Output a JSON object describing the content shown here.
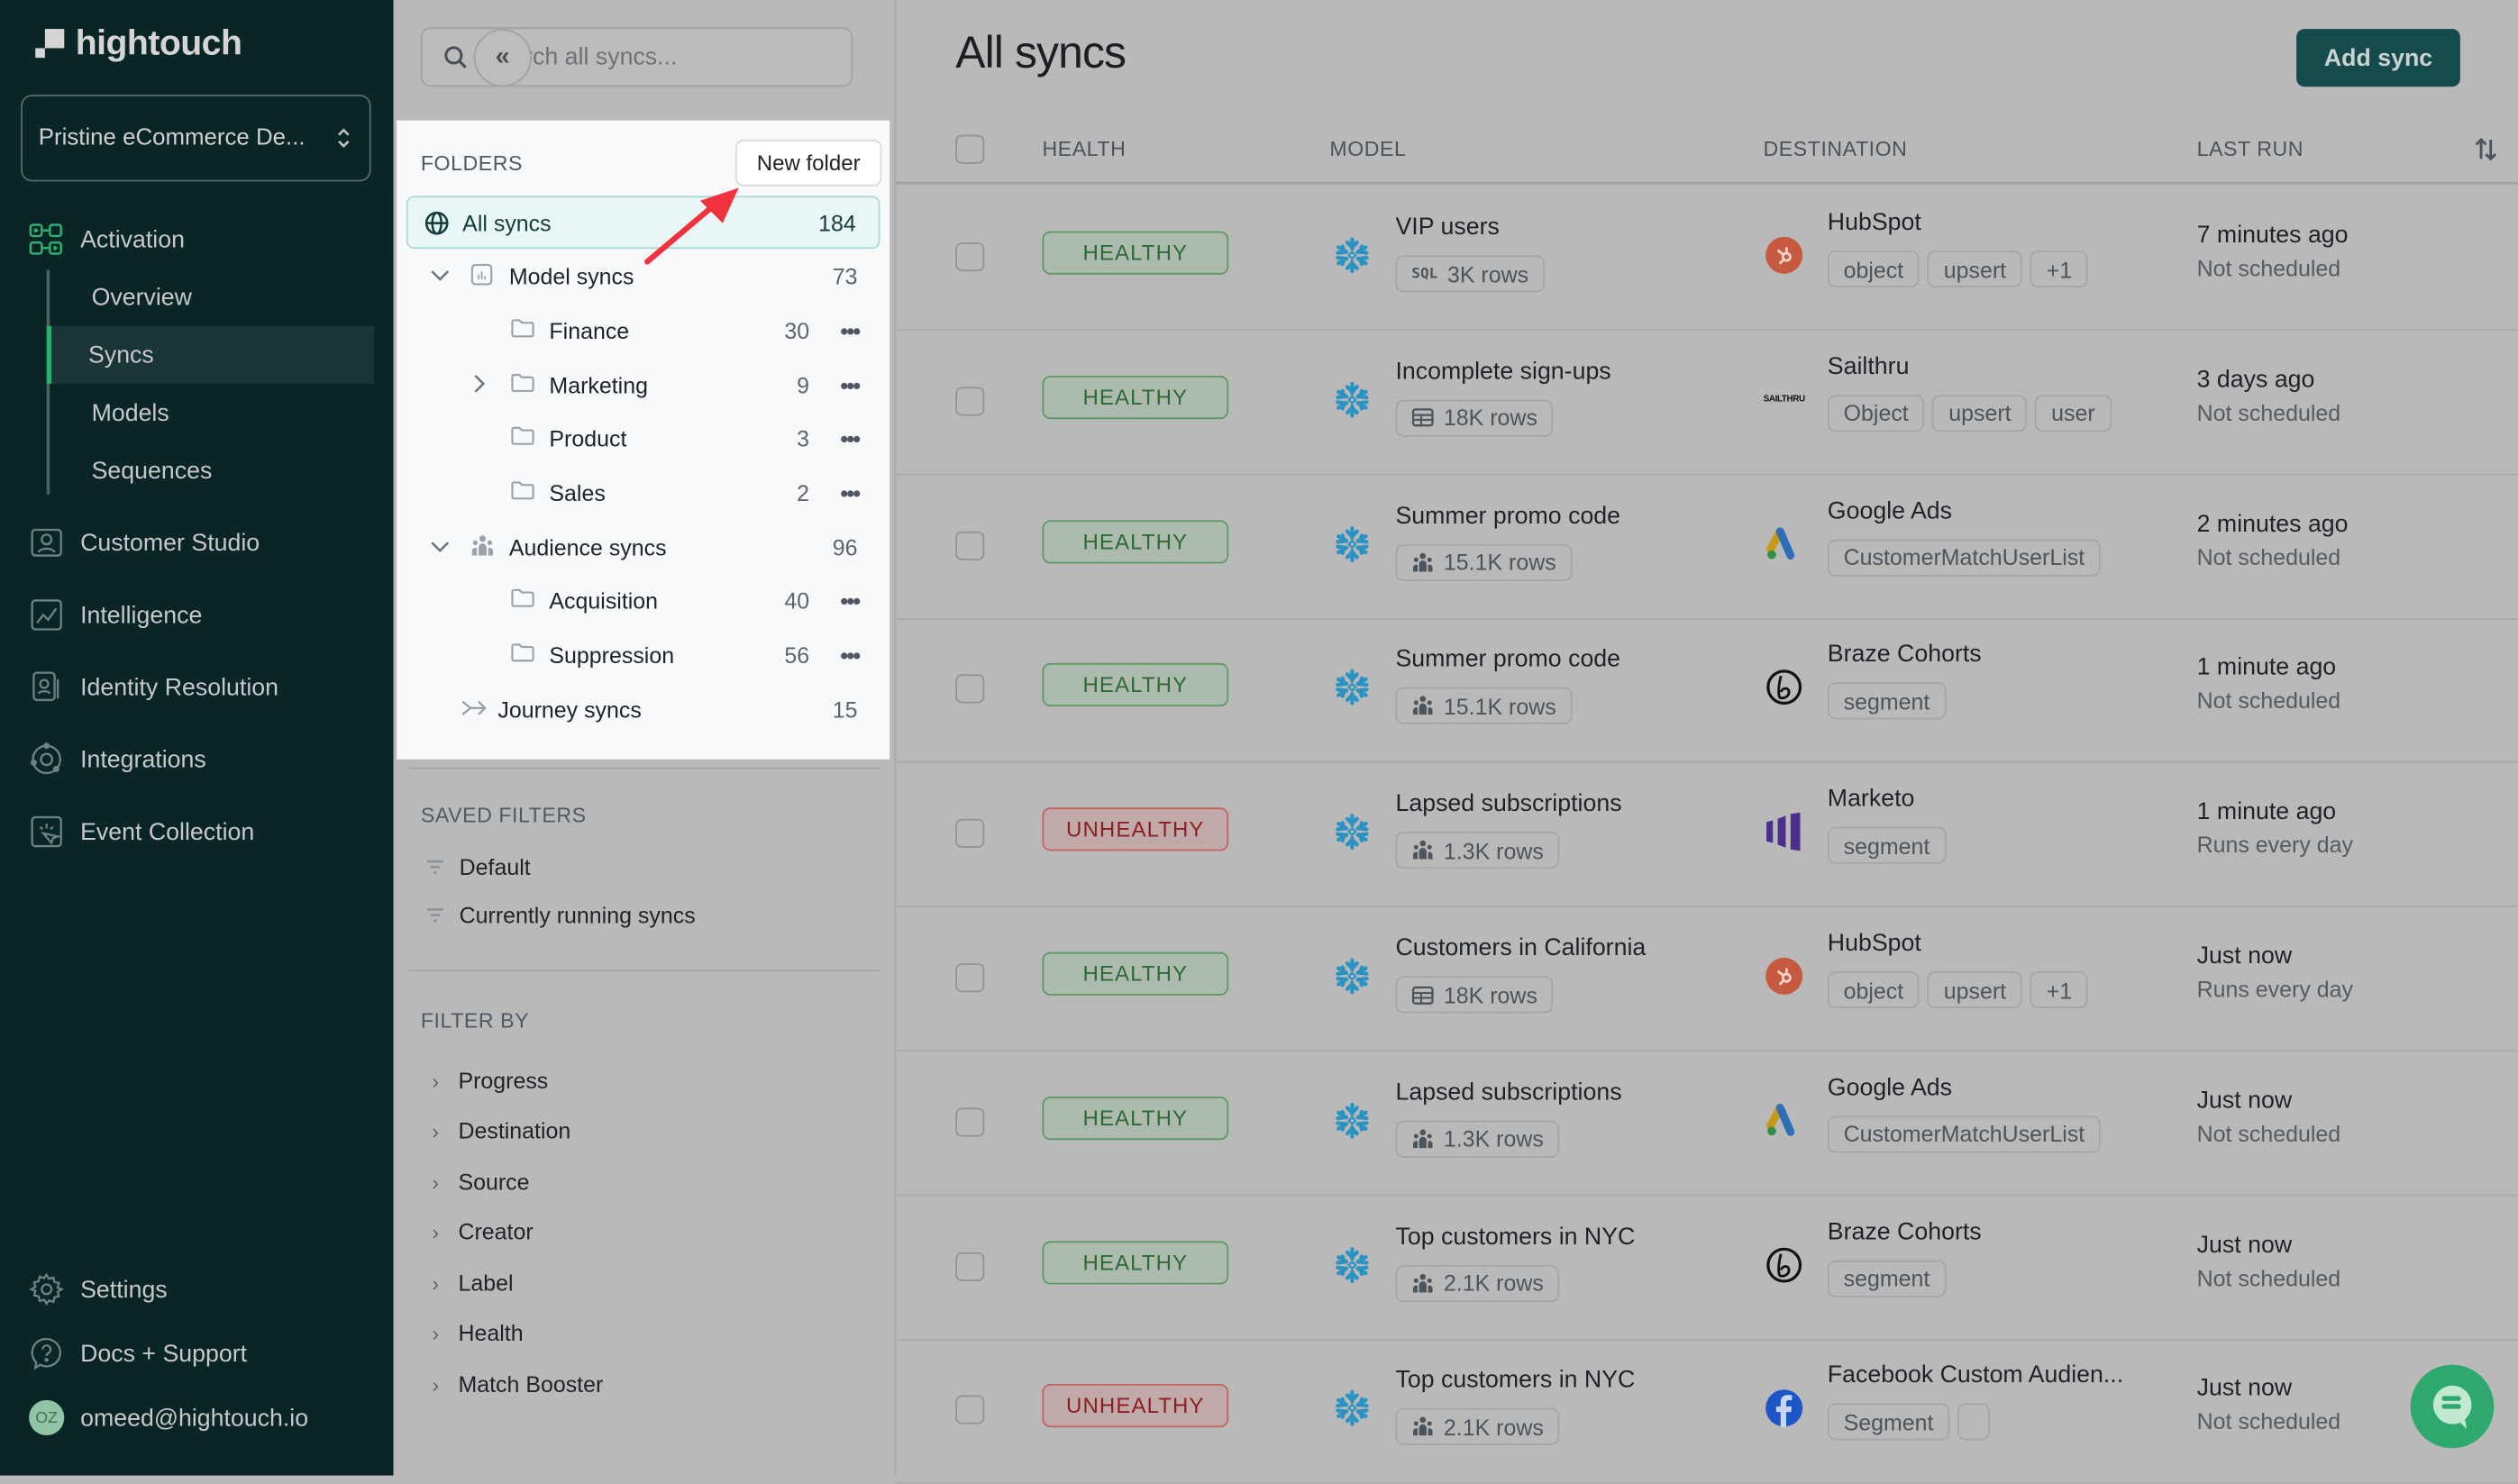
{
  "brand": {
    "name": "hightouch"
  },
  "workspace": {
    "name": "Pristine eCommerce De..."
  },
  "nav": {
    "items": [
      {
        "label": "Activation",
        "icon": "activation-icon"
      },
      {
        "label": "Customer Studio",
        "icon": "customer-studio-icon"
      },
      {
        "label": "Intelligence",
        "icon": "intelligence-icon"
      },
      {
        "label": "Identity Resolution",
        "icon": "identity-resolution-icon"
      },
      {
        "label": "Integrations",
        "icon": "integrations-icon"
      },
      {
        "label": "Event Collection",
        "icon": "event-collection-icon"
      }
    ],
    "activation_sub": [
      {
        "label": "Overview"
      },
      {
        "label": "Syncs",
        "active": true
      },
      {
        "label": "Models"
      },
      {
        "label": "Sequences"
      }
    ],
    "bottom": [
      {
        "label": "Settings",
        "icon": "gear-icon"
      },
      {
        "label": "Docs + Support",
        "icon": "help-icon"
      }
    ],
    "user": {
      "initials": "OZ",
      "email": "omeed@hightouch.io"
    }
  },
  "filter_panel": {
    "search_placeholder": "Search all syncs...",
    "collapse_label": "«",
    "folders_title": "FOLDERS",
    "new_folder_label": "New folder",
    "folders": [
      {
        "label": "All syncs",
        "count": "184",
        "icon": "globe-icon",
        "selected": true
      },
      {
        "label": "Model syncs",
        "count": "73",
        "icon": "model-icon",
        "expanded": true
      },
      {
        "label": "Finance",
        "count": "30",
        "icon": "folder-icon"
      },
      {
        "label": "Marketing",
        "count": "9",
        "icon": "folder-icon",
        "collapsed": true
      },
      {
        "label": "Product",
        "count": "3",
        "icon": "folder-icon"
      },
      {
        "label": "Sales",
        "count": "2",
        "icon": "folder-icon"
      },
      {
        "label": "Audience syncs",
        "count": "96",
        "icon": "audience-icon",
        "expanded": true
      },
      {
        "label": "Acquisition",
        "count": "40",
        "icon": "folder-icon"
      },
      {
        "label": "Suppression",
        "count": "56",
        "icon": "folder-icon"
      },
      {
        "label": "Journey syncs",
        "count": "15",
        "icon": "journey-icon"
      }
    ],
    "more_label": "•••",
    "saved_filters_title": "SAVED FILTERS",
    "saved_filters": [
      {
        "label": "Default"
      },
      {
        "label": "Currently running syncs"
      }
    ],
    "filter_by_title": "FILTER BY",
    "filter_by": [
      {
        "label": "Progress"
      },
      {
        "label": "Destination"
      },
      {
        "label": "Source"
      },
      {
        "label": "Creator"
      },
      {
        "label": "Label"
      },
      {
        "label": "Health"
      },
      {
        "label": "Match Booster"
      }
    ]
  },
  "main": {
    "title": "All syncs",
    "add_sync_label": "Add sync",
    "columns": {
      "health": "HEALTH",
      "model": "MODEL",
      "destination": "DESTINATION",
      "last_run": "LAST RUN"
    },
    "colors": {
      "accent": "#154b4c",
      "healthy": "#2d6a34",
      "unhealthy": "#8a1f1f",
      "snowflake": "#29a3d9"
    },
    "rows": [
      {
        "health": "HEALTHY",
        "status": "healthy",
        "model": "VIP users",
        "rows_icon": "sql-icon",
        "rows_prefix": "SQL",
        "rows": "3K rows",
        "destination": "HubSpot",
        "dest_icon": "hubspot",
        "tags": [
          "object",
          "upsert",
          "+1"
        ],
        "last_run": "7 minutes ago",
        "schedule": "Not scheduled"
      },
      {
        "health": "HEALTHY",
        "status": "healthy",
        "model": "Incomplete sign-ups",
        "rows_icon": "table-icon",
        "rows": "18K rows",
        "destination": "Sailthru",
        "dest_icon": "sailthru",
        "dest_logo_text": "SAILTHRU",
        "tags": [
          "Object",
          "upsert",
          "user"
        ],
        "last_run": "3 days ago",
        "schedule": "Not scheduled"
      },
      {
        "health": "HEALTHY",
        "status": "healthy",
        "model": "Summer promo code",
        "rows_icon": "audience-icon",
        "rows": "15.1K rows",
        "destination": "Google Ads",
        "dest_icon": "googleads",
        "tags": [
          "CustomerMatchUserList"
        ],
        "last_run": "2 minutes ago",
        "schedule": "Not scheduled"
      },
      {
        "health": "HEALTHY",
        "status": "healthy",
        "model": "Summer promo code",
        "rows_icon": "audience-icon",
        "rows": "15.1K rows",
        "destination": "Braze Cohorts",
        "dest_icon": "braze",
        "tags": [
          "segment"
        ],
        "last_run": "1 minute ago",
        "schedule": "Not scheduled"
      },
      {
        "health": "UNHEALTHY",
        "status": "unhealthy",
        "model": "Lapsed subscriptions",
        "rows_icon": "audience-icon",
        "rows": "1.3K rows",
        "destination": "Marketo",
        "dest_icon": "marketo",
        "tags": [
          "segment"
        ],
        "last_run": "1 minute ago",
        "schedule": "Runs every day"
      },
      {
        "health": "HEALTHY",
        "status": "healthy",
        "model": "Customers in California",
        "rows_icon": "table-icon",
        "rows": "18K rows",
        "destination": "HubSpot",
        "dest_icon": "hubspot",
        "tags": [
          "object",
          "upsert",
          "+1"
        ],
        "last_run": "Just now",
        "schedule": "Runs every day"
      },
      {
        "health": "HEALTHY",
        "status": "healthy",
        "model": "Lapsed subscriptions",
        "rows_icon": "audience-icon",
        "rows": "1.3K rows",
        "destination": "Google Ads",
        "dest_icon": "googleads",
        "tags": [
          "CustomerMatchUserList"
        ],
        "last_run": "Just now",
        "schedule": "Not scheduled"
      },
      {
        "health": "HEALTHY",
        "status": "healthy",
        "model": "Top customers in NYC",
        "rows_icon": "audience-icon",
        "rows": "2.1K rows",
        "destination": "Braze Cohorts",
        "dest_icon": "braze",
        "tags": [
          "segment"
        ],
        "last_run": "Just now",
        "schedule": "Not scheduled"
      },
      {
        "health": "UNHEALTHY",
        "status": "unhealthy",
        "model": "Top customers in NYC",
        "rows_icon": "audience-icon",
        "rows": "2.1K rows",
        "destination": "Facebook Custom Audien...",
        "dest_icon": "facebook",
        "tags": [
          "Segment",
          ""
        ],
        "last_run": "Just now",
        "schedule": "Not scheduled"
      }
    ]
  }
}
